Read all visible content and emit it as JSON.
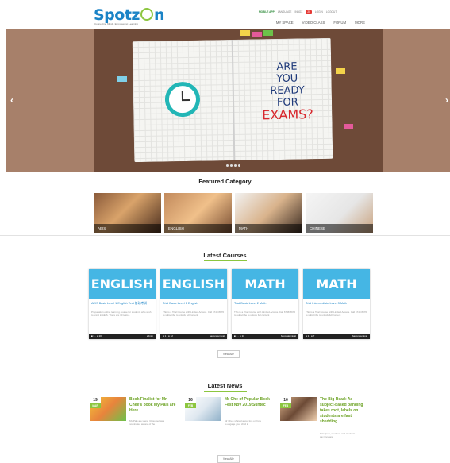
{
  "header": {
    "logo_text": "Spotz",
    "logo_o": "O",
    "logo_end": "n",
    "tagline": "Connecting Minds, Empowering Learning",
    "top_links": [
      {
        "label": "MOBILE APP",
        "kind": "mob"
      },
      {
        "label": "LANGUAGE",
        "kind": ""
      },
      {
        "label": "INBOX",
        "kind": ""
      },
      {
        "label": "20",
        "kind": "bdg"
      },
      {
        "label": "LOGIN",
        "kind": ""
      },
      {
        "label": "LOGOUT",
        "kind": ""
      }
    ],
    "nav": [
      "MY SPACE",
      "VIDEO CLASS",
      "FORUM",
      "MORE"
    ]
  },
  "hero": {
    "line1": "ARE",
    "line2": "YOU",
    "line3": "READY",
    "line4": "FOR",
    "line5": "EXAMS?",
    "prev_arrow": "‹",
    "next_arrow": "›"
  },
  "featured": {
    "title": "Featured Category",
    "items": [
      "AEIS",
      "ENGLISH",
      "MATH",
      "CHINESE"
    ]
  },
  "courses": {
    "title": "Latest Courses",
    "items": [
      {
        "banner": "ENGLISH",
        "title": "AEIS Basic Level 1 English Test 基础考试",
        "desc": "Preparation online learning course for students who wish to enrol in AEIS. There are 10 tests...",
        "stats": "■ 6 · ● 20",
        "author": "admin"
      },
      {
        "banner": "ENGLISH",
        "title": "Trial Basic Level 1 English",
        "desc": "This is a Trial Course with Limited Access. Call 6748 8976 to subscribe to unlock full content",
        "stats": "■ 1 · ● 12",
        "author": "baconalemical"
      },
      {
        "banner": "MATH",
        "title": "Trial Basic Level 2 Math",
        "desc": "This is a Trial Course with Limited Access. Call 6748 8976 to subscribe to unlock full content",
        "stats": "■ 1 · ● 11",
        "author": "baconalemical"
      },
      {
        "banner": "MATH",
        "title": "Trial Intermediate Level 3 Math",
        "desc": "This is a Trial Course with Limited Access. Call 6748 8976 to subscribe to unlock full content",
        "stats": "■ 1 · ● 7",
        "author": "baconalemical"
      }
    ],
    "view_all": "View All ›"
  },
  "news": {
    "title": "Latest News",
    "items": [
      {
        "day": "19",
        "month": "MAR",
        "title": "Book Finalist for Mr Chee's book My Pals are Here",
        "desc": "My Pals are Here! (Upsome) was nominated as one of the"
      },
      {
        "day": "16",
        "month": "FEB",
        "title": "Mr Che of Popular Book Fest Nov 2019 Suntec",
        "desc": "Mr Chee shared about tips on how to engage your child in"
      },
      {
        "day": "16",
        "month": "FEB",
        "title": "The Big Read: As subject-based banding takes root, labels on students are fast shedding",
        "desc": "Principals, teachers and students say they are"
      }
    ],
    "view_all": "View All ›"
  }
}
